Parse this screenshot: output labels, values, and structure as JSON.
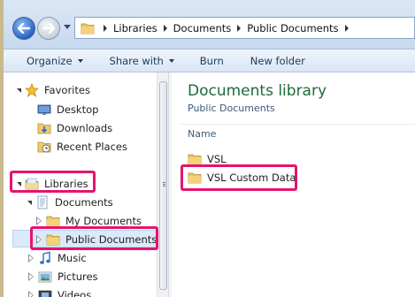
{
  "addressbar": {
    "crumbs": [
      "Libraries",
      "Documents",
      "Public Documents"
    ]
  },
  "toolbar": {
    "organize": "Organize",
    "share_with": "Share with",
    "burn": "Burn",
    "new_folder": "New folder"
  },
  "nav": {
    "favorites": {
      "label": "Favorites",
      "items": [
        "Desktop",
        "Downloads",
        "Recent Places"
      ]
    },
    "libraries": {
      "label": "Libraries",
      "documents": {
        "label": "Documents",
        "children": [
          "My Documents",
          "Public Documents"
        ]
      },
      "others": [
        "Music",
        "Pictures",
        "Videos"
      ]
    },
    "selected": "Public Documents"
  },
  "content": {
    "title": "Documents library",
    "subtitle": "Public Documents",
    "column_name": "Name",
    "files": [
      "VSL",
      "VSL Custom Data"
    ]
  },
  "colors": {
    "highlight": "#e6136c",
    "library_title": "#1e6b3a"
  }
}
